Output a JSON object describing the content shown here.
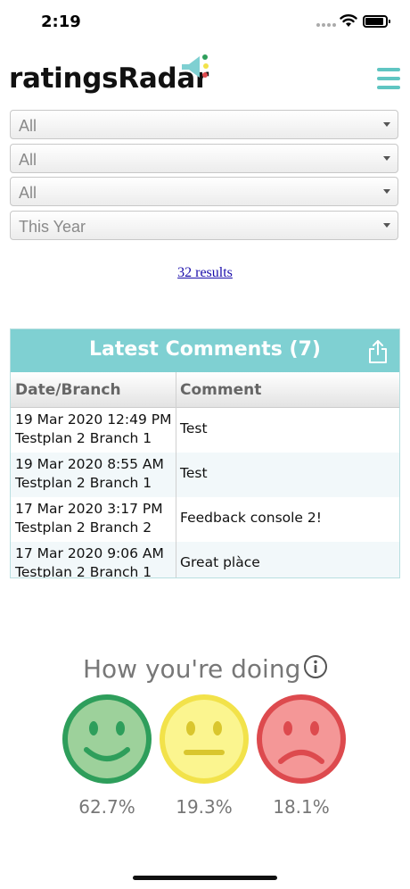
{
  "status_bar": {
    "time": "2:19"
  },
  "header": {
    "brand": "ratingsRadar"
  },
  "filters": [
    {
      "value": "All"
    },
    {
      "value": "All"
    },
    {
      "value": "All"
    },
    {
      "value": "This Year"
    }
  ],
  "results": {
    "label": "32 results"
  },
  "comments": {
    "title": "Latest Comments (7)",
    "columns": [
      "Date/Branch",
      "Comment"
    ],
    "rows": [
      {
        "date": "19 Mar 2020 12:49 PM",
        "branch": "Testplan 2 Branch 1",
        "comment": "Test"
      },
      {
        "date": "19 Mar 2020 8:55 AM",
        "branch": "Testplan 2 Branch 1",
        "comment": "Test"
      },
      {
        "date": "17 Mar 2020 3:17 PM",
        "branch": "Testplan 2 Branch 2",
        "comment": "Feedback console 2!"
      },
      {
        "date": "17 Mar 2020 9:06 AM",
        "branch": "Testplan 2 Branch 1",
        "comment": "Great plàce"
      }
    ]
  },
  "doing": {
    "title": "How you're doing",
    "happy_pct": "62.7%",
    "neutral_pct": "19.3%",
    "sad_pct": "18.1%"
  },
  "colors": {
    "accent": "#7fd0d2",
    "menu": "#5fc5c2",
    "happy": "#2e9e5b",
    "neutral": "#f2e24a",
    "sad": "#dd4a4e"
  },
  "icons": [
    "wifi-icon",
    "battery-icon",
    "megaphone-icon",
    "menu-icon",
    "share-icon",
    "info-icon",
    "happy-face-icon",
    "neutral-face-icon",
    "sad-face-icon"
  ]
}
